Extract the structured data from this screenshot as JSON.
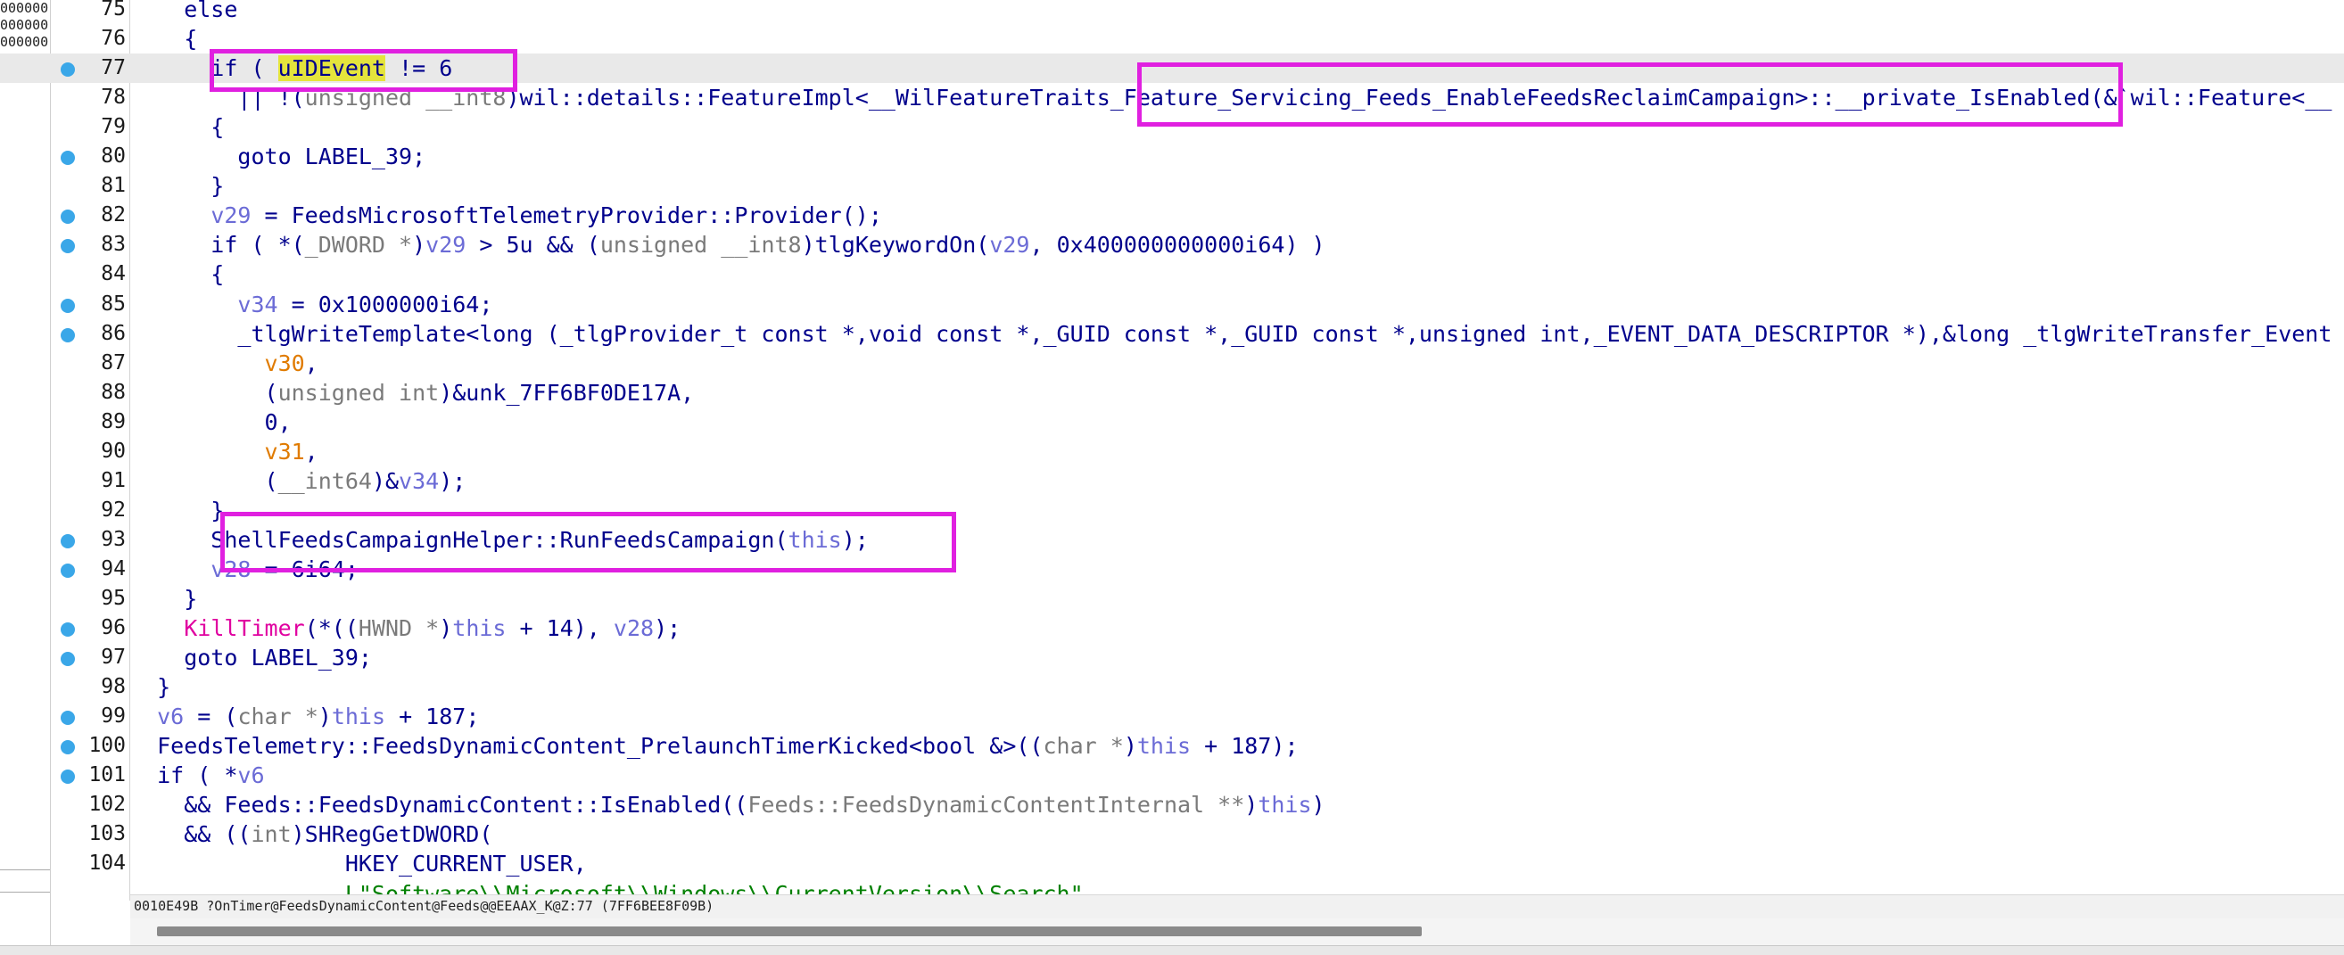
{
  "left_panel": {
    "addresses": [
      "000000",
      "000000",
      "000000",
      "000000"
    ]
  },
  "highlight_color": "#e020e0",
  "lines": [
    {
      "n": "75",
      "bp": false,
      "hl": false,
      "parts": [
        {
          "t": "    else"
        }
      ]
    },
    {
      "n": "76",
      "bp": false,
      "hl": false,
      "parts": [
        {
          "t": "    {"
        }
      ]
    },
    {
      "n": "77",
      "bp": true,
      "hl": true,
      "parts": [
        {
          "t": "      if ( "
        },
        {
          "t": "uIDEvent",
          "c": "yhl"
        },
        {
          "t": " != 6"
        }
      ]
    },
    {
      "n": "78",
      "bp": false,
      "hl": false,
      "parts": [
        {
          "t": "        || !("
        },
        {
          "t": "unsigned __int8",
          "c": "gr"
        },
        {
          "t": ")wil::details::FeatureImpl<__WilFeatureTraits_Feature_Servicing_Feeds_EnableFeedsReclaimCampaign>::__private_IsEnabled(&`wil::Feature<__"
        }
      ]
    },
    {
      "n": "79",
      "bp": false,
      "hl": false,
      "parts": [
        {
          "t": "      {"
        }
      ]
    },
    {
      "n": "80",
      "bp": true,
      "hl": false,
      "parts": [
        {
          "t": "        goto LABEL_39;"
        }
      ]
    },
    {
      "n": "81",
      "bp": false,
      "hl": false,
      "parts": [
        {
          "t": "      }"
        }
      ]
    },
    {
      "n": "82",
      "bp": true,
      "hl": false,
      "parts": [
        {
          "t": "      "
        },
        {
          "t": "v29",
          "c": "v"
        },
        {
          "t": " = FeedsMicrosoftTelemetryProvider::Provider();"
        }
      ]
    },
    {
      "n": "83",
      "bp": true,
      "hl": false,
      "parts": [
        {
          "t": "      if ( *("
        },
        {
          "t": "_DWORD *",
          "c": "gr"
        },
        {
          "t": ")"
        },
        {
          "t": "v29",
          "c": "v"
        },
        {
          "t": " > 5u && ("
        },
        {
          "t": "unsigned __int8",
          "c": "gr"
        },
        {
          "t": ")tlgKeywordOn("
        },
        {
          "t": "v29",
          "c": "v"
        },
        {
          "t": ", 0x400000000000i64) )"
        }
      ]
    },
    {
      "n": "84",
      "bp": false,
      "hl": false,
      "parts": [
        {
          "t": "      {"
        }
      ]
    },
    {
      "n": "85",
      "bp": true,
      "hl": false,
      "parts": [
        {
          "t": "        "
        },
        {
          "t": "v34",
          "c": "v"
        },
        {
          "t": " = 0x1000000i64;"
        }
      ]
    },
    {
      "n": "86",
      "bp": true,
      "hl": false,
      "parts": [
        {
          "t": "        _tlgWriteTemplate<long (_tlgProvider_t const *,void const *,_GUID const *,_GUID const *,unsigned int,_EVENT_DATA_DESCRIPTOR *),&long _tlgWriteTransfer_Event"
        }
      ]
    },
    {
      "n": "87",
      "bp": false,
      "hl": false,
      "parts": [
        {
          "t": "          "
        },
        {
          "t": "v30",
          "c": "vo"
        },
        {
          "t": ","
        }
      ]
    },
    {
      "n": "88",
      "bp": false,
      "hl": false,
      "parts": [
        {
          "t": "          ("
        },
        {
          "t": "unsigned int",
          "c": "gr"
        },
        {
          "t": ")&unk_7FF6BF0DE17A,"
        }
      ]
    },
    {
      "n": "89",
      "bp": false,
      "hl": false,
      "parts": [
        {
          "t": "          0,"
        }
      ]
    },
    {
      "n": "90",
      "bp": false,
      "hl": false,
      "parts": [
        {
          "t": "          "
        },
        {
          "t": "v31",
          "c": "vo"
        },
        {
          "t": ","
        }
      ]
    },
    {
      "n": "91",
      "bp": false,
      "hl": false,
      "parts": [
        {
          "t": "          ("
        },
        {
          "t": "__int64",
          "c": "gr"
        },
        {
          "t": ")&"
        },
        {
          "t": "v34",
          "c": "v"
        },
        {
          "t": ");"
        }
      ]
    },
    {
      "n": "92",
      "bp": false,
      "hl": false,
      "parts": [
        {
          "t": "      }"
        }
      ]
    },
    {
      "n": "93",
      "bp": true,
      "hl": false,
      "parts": [
        {
          "t": "      ShellFeedsCampaignHelper::RunFeedsCampaign("
        },
        {
          "t": "this",
          "c": "v"
        },
        {
          "t": ");"
        }
      ]
    },
    {
      "n": "94",
      "bp": true,
      "hl": false,
      "parts": [
        {
          "t": "      "
        },
        {
          "t": "v28",
          "c": "v"
        },
        {
          "t": " = 6i64;"
        }
      ]
    },
    {
      "n": "95",
      "bp": false,
      "hl": false,
      "parts": [
        {
          "t": "    }"
        }
      ]
    },
    {
      "n": "96",
      "bp": true,
      "hl": false,
      "parts": [
        {
          "t": "    "
        },
        {
          "t": "KillTimer",
          "c": "pk"
        },
        {
          "t": "(*(("
        },
        {
          "t": "HWND *",
          "c": "gr"
        },
        {
          "t": ")"
        },
        {
          "t": "this",
          "c": "v"
        },
        {
          "t": " + 14), "
        },
        {
          "t": "v28",
          "c": "v"
        },
        {
          "t": ");"
        }
      ]
    },
    {
      "n": "97",
      "bp": true,
      "hl": false,
      "parts": [
        {
          "t": "    goto LABEL_39;"
        }
      ]
    },
    {
      "n": "98",
      "bp": false,
      "hl": false,
      "parts": [
        {
          "t": "  }"
        }
      ]
    },
    {
      "n": "99",
      "bp": true,
      "hl": false,
      "parts": [
        {
          "t": "  "
        },
        {
          "t": "v6",
          "c": "v"
        },
        {
          "t": " = ("
        },
        {
          "t": "char *",
          "c": "gr"
        },
        {
          "t": ")"
        },
        {
          "t": "this",
          "c": "v"
        },
        {
          "t": " + 187;"
        }
      ]
    },
    {
      "n": "100",
      "bp": true,
      "hl": false,
      "parts": [
        {
          "t": "  FeedsTelemetry::FeedsDynamicContent_PrelaunchTimerKicked<bool &>(("
        },
        {
          "t": "char *",
          "c": "gr"
        },
        {
          "t": ")"
        },
        {
          "t": "this",
          "c": "v"
        },
        {
          "t": " + 187);"
        }
      ]
    },
    {
      "n": "101",
      "bp": true,
      "hl": false,
      "parts": [
        {
          "t": "  if ( *"
        },
        {
          "t": "v6",
          "c": "v"
        }
      ]
    },
    {
      "n": "102",
      "bp": false,
      "hl": false,
      "parts": [
        {
          "t": "    && Feeds::FeedsDynamicContent::IsEnabled(("
        },
        {
          "t": "Feeds::FeedsDynamicContentInternal **",
          "c": "gr"
        },
        {
          "t": ")"
        },
        {
          "t": "this",
          "c": "v"
        },
        {
          "t": ")"
        }
      ]
    },
    {
      "n": "103",
      "bp": false,
      "hl": false,
      "parts": [
        {
          "t": "    && (("
        },
        {
          "t": "int",
          "c": "gr"
        },
        {
          "t": ")SHRegGetDWORD("
        }
      ]
    },
    {
      "n": "104",
      "bp": false,
      "hl": false,
      "parts": [
        {
          "t": "                HKEY_CURRENT_USER,"
        }
      ]
    },
    {
      "n": "",
      "bp": false,
      "hl": false,
      "parts": [
        {
          "t": "                "
        },
        {
          "t": "L\"Software\\\\Microsoft\\\\Windows\\\\CurrentVersion\\\\Search\",",
          "c": "gn"
        }
      ]
    }
  ],
  "status": {
    "text": "0010E49B ?OnTimer@FeedsDynamicContent@Feeds@@EEAAX_K@Z:77 (7FF6BEE8F09B)"
  }
}
